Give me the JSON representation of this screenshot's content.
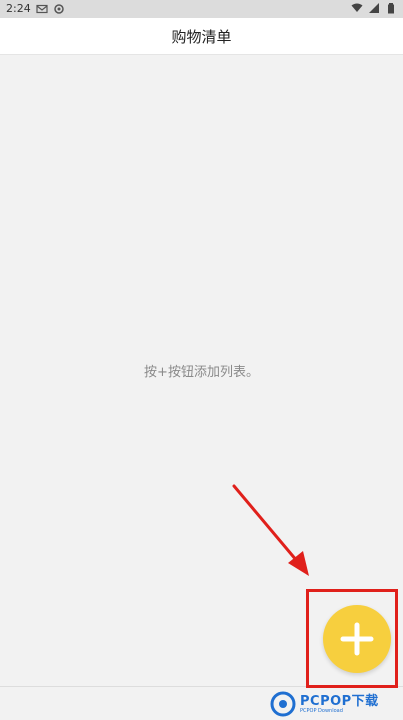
{
  "status_bar": {
    "time": "2:24",
    "left_icons": [
      "gmail-icon",
      "settings-icon"
    ],
    "right_icons": [
      "wifi-icon",
      "signal-icon",
      "battery-icon"
    ]
  },
  "app_bar": {
    "title": "购物清单"
  },
  "main": {
    "empty_hint": "按+按钮添加列表。"
  },
  "fab": {
    "icon": "plus-icon",
    "color": "#f7cf3e"
  },
  "annotation": {
    "color": "#e0201b"
  },
  "watermark": {
    "brand": "PCPOP下载",
    "sub": "PCPOP Download"
  }
}
